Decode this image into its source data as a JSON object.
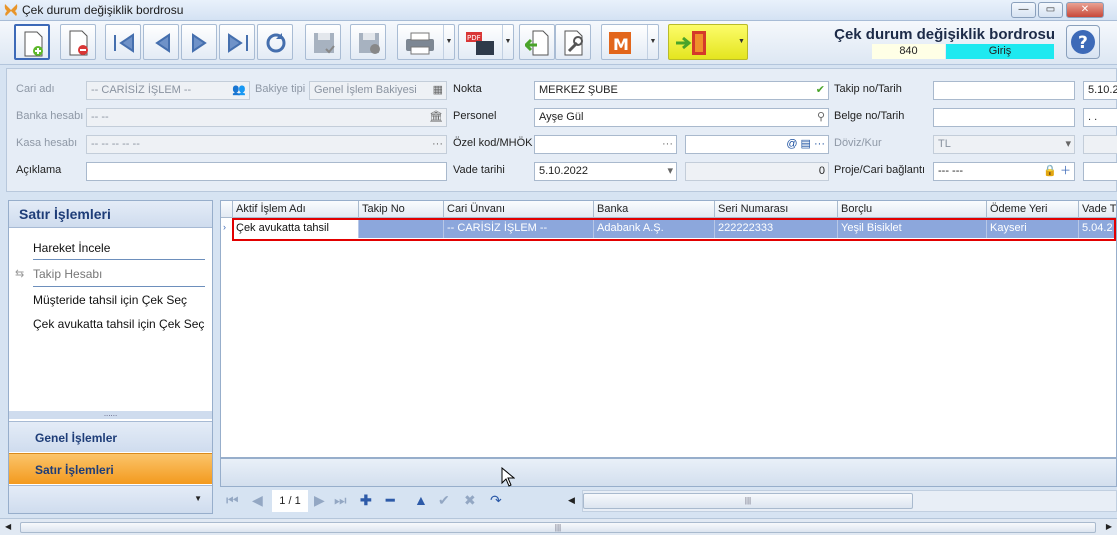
{
  "window": {
    "title": "Çek durum değişiklik bordrosu"
  },
  "header": {
    "form_title": "Çek durum değişiklik bordrosu",
    "code": "840",
    "status": "Giriş"
  },
  "form": {
    "cari_adi": {
      "label": "Cari adı",
      "value": "-- CARİSİZ İŞLEM --"
    },
    "bakiye_tipi": {
      "label": "Bakiye tipi",
      "value": "Genel İşlem Bakiyesi"
    },
    "banka_hesabi": {
      "label": "Banka hesabı",
      "value": "-- --"
    },
    "kasa_hesabi": {
      "label": "Kasa hesabı",
      "value": "-- -- -- -- --"
    },
    "aciklama": {
      "label": "Açıklama",
      "value": ""
    },
    "nokta": {
      "label": "Nokta",
      "value": "MERKEZ ŞUBE"
    },
    "personel": {
      "label": "Personel",
      "value": "Ayşe Gül"
    },
    "ozel_kod": {
      "label": "Özel kod/MHÖK",
      "value": "",
      "value2": ""
    },
    "vade_tarihi": {
      "label": "Vade tarihi",
      "value": "5.10.2022",
      "amount": "0"
    },
    "takip_no": {
      "label": "Takip no/Tarih",
      "value": "",
      "date": "5.10.2"
    },
    "belge_no": {
      "label": "Belge no/Tarih",
      "value": "",
      "date": ". ."
    },
    "doviz": {
      "label": "Döviz/Kur",
      "value": "TL"
    },
    "proje": {
      "label": "Proje/Cari bağlantı",
      "value": "--- ---"
    }
  },
  "left_panel": {
    "header": "Satır İşlemleri",
    "items": [
      "Hareket İncele",
      "Takip Hesabı",
      "Müşteride tahsil için Çek Seç",
      "Çek avukatta tahsil için Çek Seç"
    ],
    "grip": "......",
    "nav": [
      "Genel İşlemler",
      "Satır İşlemleri"
    ]
  },
  "grid": {
    "columns": [
      "Aktif İşlem Adı",
      "Takip No",
      "Cari Ünvanı",
      "Banka",
      "Seri Numarası",
      "Borçlu",
      "Ödeme Yeri",
      "Vade T"
    ],
    "rows": [
      [
        "Çek avukatta tahsil",
        "",
        "-- CARİSİZ İŞLEM --",
        "Adabank A.Ş.",
        "222222333",
        "Yeşil Bisiklet",
        "Kayseri",
        "5.04.2"
      ]
    ]
  },
  "pager": {
    "page": "1 / 1"
  },
  "colors": {
    "selected_row": "#8ca7dc",
    "highlight_border": "#e20000",
    "status": "#1ee9f0",
    "active_nav": "#f6a12c"
  }
}
